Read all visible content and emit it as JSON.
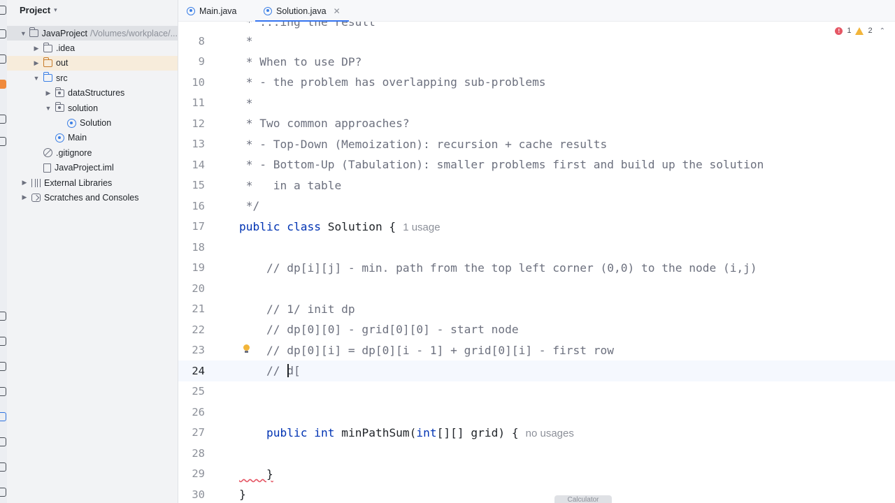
{
  "project_panel": {
    "title": "Project",
    "tree": [
      {
        "label": "JavaProject",
        "path": "/Volumes/workplace/..."
      },
      {
        "label": ".idea"
      },
      {
        "label": "out"
      },
      {
        "label": "src"
      },
      {
        "label": "dataStructures"
      },
      {
        "label": "solution"
      },
      {
        "label": "Solution"
      },
      {
        "label": "Main"
      },
      {
        "label": ".gitignore"
      },
      {
        "label": "JavaProject.iml"
      },
      {
        "label": "External Libraries"
      },
      {
        "label": "Scratches and Consoles"
      }
    ]
  },
  "tabs": [
    {
      "label": "Main.java"
    },
    {
      "label": "Solution.java"
    }
  ],
  "inspections": {
    "errors": "1",
    "warnings": "2"
  },
  "code_lines": [
    {
      "n": "8",
      "text": " *"
    },
    {
      "n": "9",
      "text": " * When to use DP?"
    },
    {
      "n": "10",
      "text": " * - the problem has overlapping sub-problems"
    },
    {
      "n": "11",
      "text": " *"
    },
    {
      "n": "12",
      "text": " * Two common approaches?"
    },
    {
      "n": "13",
      "text": " * - Top-Down (Memoization): recursion + cache results"
    },
    {
      "n": "14",
      "text": " * - Bottom-Up (Tabulation): smaller problems first and build up the solution"
    },
    {
      "n": "15",
      "text": " *   in a table"
    },
    {
      "n": "16",
      "text": " */"
    },
    {
      "n": "17",
      "kw1": "public",
      "kw2": "class",
      "text": "Solution {",
      "hint": "1 usage"
    },
    {
      "n": "18",
      "text": ""
    },
    {
      "n": "19",
      "text": "    // dp[i][j] - min. path from the top left corner (0,0) to the node (i,j)"
    },
    {
      "n": "20",
      "text": ""
    },
    {
      "n": "21",
      "text": "    // 1/ init dp"
    },
    {
      "n": "22",
      "text": "    // dp[0][0] - grid[0][0] - start node"
    },
    {
      "n": "23",
      "text": "    // dp[0][i] = dp[0][i - 1] + grid[0][i] - first row"
    },
    {
      "n": "24",
      "text": "    // d["
    },
    {
      "n": "25",
      "text": ""
    },
    {
      "n": "26",
      "text": ""
    },
    {
      "n": "27",
      "kw1": "public",
      "kw2": "int",
      "text": "minPathSum(",
      "kw3": "int",
      "text2": "[][] grid) {",
      "hint": "no usages"
    },
    {
      "n": "28",
      "text": ""
    },
    {
      "n": "29",
      "text": "    }"
    },
    {
      "n": "30",
      "text": "}"
    }
  ],
  "partial_top_line": " * ...ing the result",
  "bottom_peek": "Calculator"
}
